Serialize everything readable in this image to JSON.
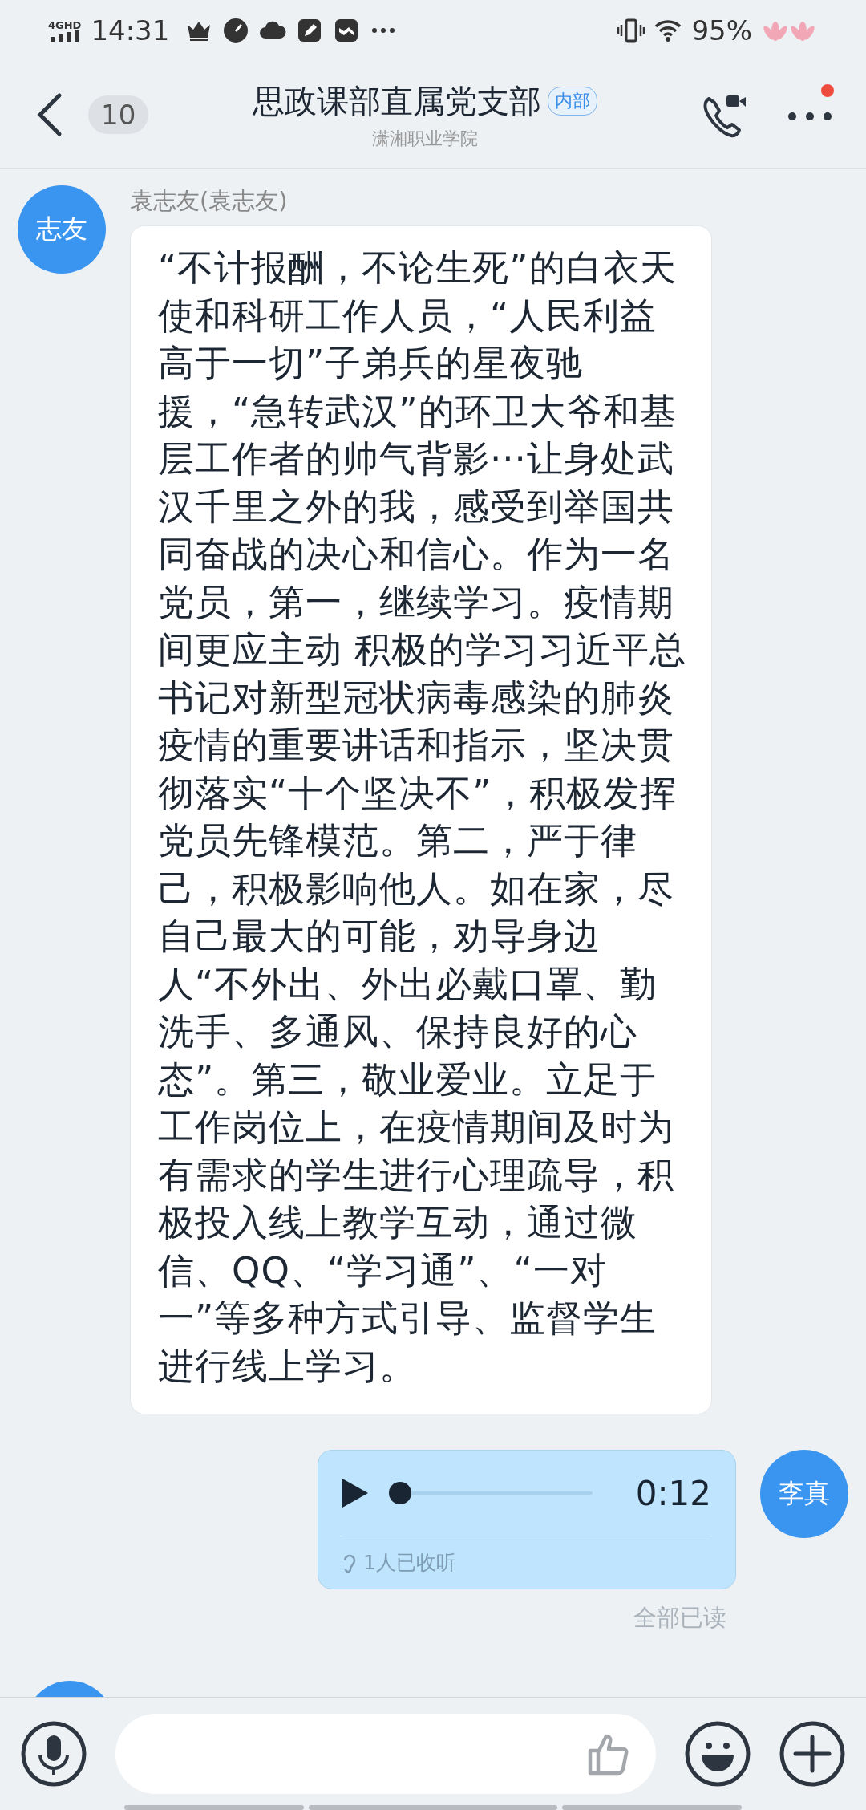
{
  "status_bar": {
    "network": "4GHD",
    "time": "14:31",
    "battery": "95%"
  },
  "header": {
    "unread_count": "10",
    "title": "思政课部直属党支部",
    "badge": "内部",
    "subtitle": "潇湘职业学院",
    "has_notification": true
  },
  "messages": [
    {
      "kind": "text",
      "outgoing": false,
      "avatar": "志友",
      "sender": "袁志友(袁志友)",
      "text": "“不计报酬，不论生死”的白衣天使和科研工作人员，“人民利益高于一切”子弟兵的星夜驰援，“急转武汉”的环卫大爷和基层工作者的帅气背影···让身处武汉千里之外的我，感受到举国共同奋战的决心和信心。作为一名党员，第一，继续学习。疫情期间更应主动 积极的学习习近平总书记对新型冠状病毒感染的肺炎疫情的重要讲话和指示，坚决贯彻落实“十个坚决不”，积极发挥党员先锋模范。第二，严于律己，积极影响他人。如在家，尽自己最大的可能，劝导身边人“不外出、外出必戴口罩、勤洗手、多通风、保持良好的心态”。第三，敬业爱业。立足于工作岗位上，在疫情期间及时为有需求的学生进行心理疏导，积极投入线上教学互动，通过微信、QQ、“学习通”、“一对一”等多种方式引导、监督学生进行线上学习。"
    },
    {
      "kind": "voice",
      "outgoing": true,
      "avatar": "李真",
      "duration": "0:12",
      "level": 0,
      "listened": "1人已收听",
      "read_status": "全部已读"
    }
  ]
}
